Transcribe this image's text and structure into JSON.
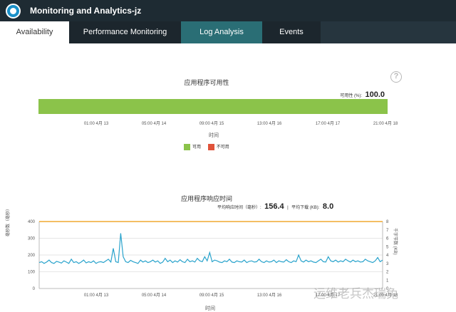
{
  "window": {
    "title": "Monitoring and Analytics-jz"
  },
  "tabs": [
    {
      "label": "Availability"
    },
    {
      "label": "Performance Monitoring"
    },
    {
      "label": "Log Analysis"
    },
    {
      "label": "Events"
    }
  ],
  "availability": {
    "title": "应用程序可用性",
    "summary_label": "可用性 (%):",
    "summary_value": "100.0",
    "x_ticks": [
      "01:00 4月 13",
      "05:00 4月 14",
      "09:00 4月 15",
      "13:00 4月 16",
      "17:00 4月 17",
      "21:00 4月 18"
    ],
    "x_label": "时间",
    "legend": [
      {
        "label": "可用",
        "color": "#8bc34a"
      },
      {
        "label": "不可用",
        "color": "#e0533a"
      }
    ],
    "help_glyph": "?"
  },
  "response": {
    "title": "应用程序响应时间",
    "avg_response_label": "平均响应时间（毫秒）:",
    "avg_response_value": "156.4",
    "separator": "|",
    "avg_download_label": "平均下载 (KB):",
    "avg_download_value": "8.0",
    "y_left_label": "毫秒数（毫秒）",
    "y_right_label": "千字节数 (KB)",
    "x_label": "时间",
    "x_ticks": [
      "01:00 4月 13",
      "05:00 4月 14",
      "09:00 4月 15",
      "13:00 4月 16",
      "17:00 4月 17",
      "21:00 4月 18"
    ]
  },
  "chart_data": {
    "type": "line",
    "title": "应用程序响应时间",
    "xlabel": "时间",
    "ylabel": "毫秒数（毫秒）",
    "ylim": [
      0,
      400
    ],
    "y_ticks": [
      "0",
      "100",
      "200",
      "300",
      "400"
    ],
    "y2label": "千字节数 (KB)",
    "y2lim": [
      0,
      8
    ],
    "y2_ticks": [
      "0",
      "1",
      "2",
      "3",
      "4",
      "5",
      "6",
      "7",
      "8"
    ],
    "series": [
      {
        "color": "#29a3cc",
        "axis": "left",
        "values": [
          155,
          160,
          150,
          158,
          170,
          155,
          150,
          162,
          158,
          152,
          165,
          158,
          150,
          175,
          155,
          160,
          150,
          158,
          170,
          153,
          160,
          155,
          165,
          150,
          158,
          160,
          155,
          165,
          175,
          158,
          240,
          160,
          155,
          330,
          190,
          160,
          155,
          168,
          160,
          155,
          150,
          170,
          158,
          165,
          155,
          160,
          170,
          158,
          165,
          150,
          158,
          180,
          160,
          170,
          155,
          165,
          158,
          172,
          160,
          155,
          175,
          160,
          165,
          158,
          180,
          165,
          160,
          190,
          165,
          215,
          160,
          170,
          165,
          158,
          155,
          165,
          160,
          175,
          158,
          155,
          165,
          160,
          158,
          170,
          155,
          162,
          165,
          158,
          160,
          175,
          160,
          155,
          165,
          158,
          160,
          170,
          155,
          165,
          160,
          158,
          172,
          160,
          155,
          165,
          160,
          200,
          165,
          158,
          170,
          160,
          165,
          158,
          155,
          165,
          175,
          160,
          158,
          190,
          165,
          160,
          170,
          158,
          165,
          160,
          175,
          165,
          158,
          170,
          160,
          165,
          158,
          160,
          175,
          165,
          160,
          155,
          165,
          185,
          160,
          170
        ]
      },
      {
        "color": "#f0a830",
        "axis": "right",
        "values": [
          8.0,
          8.0
        ]
      }
    ]
  }
}
